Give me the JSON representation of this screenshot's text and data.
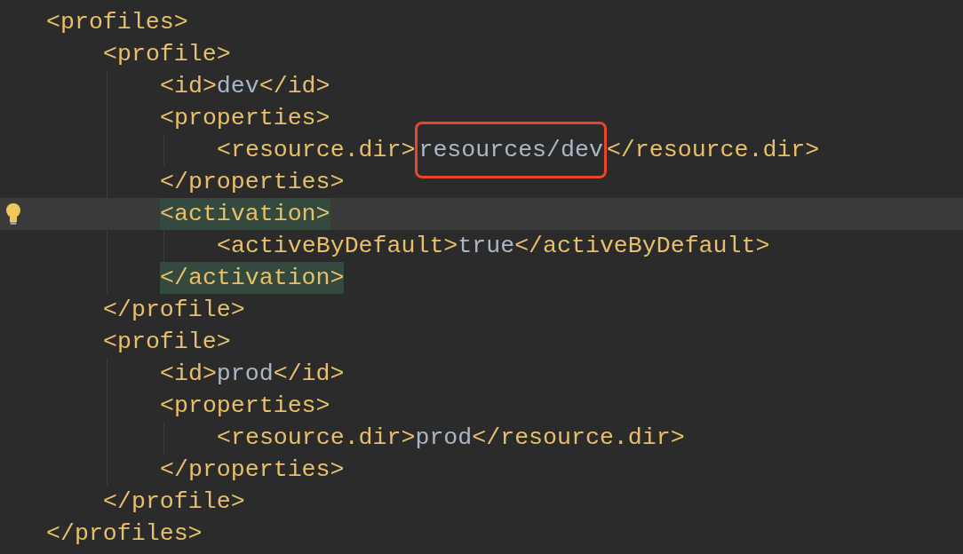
{
  "editor": {
    "lines": [
      {
        "parts": [
          {
            "kind": "tag",
            "text": "<profiles>"
          }
        ],
        "children": [
          {
            "parts": [
              {
                "kind": "tag",
                "text": "<profile>"
              }
            ],
            "children": [
              {
                "parts": [
                  {
                    "kind": "tag",
                    "text": "<id>"
                  },
                  {
                    "kind": "text",
                    "text": "dev"
                  },
                  {
                    "kind": "tag",
                    "text": "</id>"
                  }
                ]
              },
              {
                "parts": [
                  {
                    "kind": "tag",
                    "text": "<properties>"
                  }
                ],
                "children": [
                  {
                    "parts": [
                      {
                        "kind": "tag",
                        "text": "<resource.dir>"
                      },
                      {
                        "kind": "text",
                        "text": "resources/dev",
                        "boxed": true
                      },
                      {
                        "kind": "tag",
                        "text": "</resource.dir>"
                      }
                    ]
                  }
                ]
              },
              {
                "parts": [
                  {
                    "kind": "tag",
                    "text": "</properties>"
                  }
                ]
              },
              {
                "current": true,
                "bulb": true,
                "parts": [
                  {
                    "kind": "tag",
                    "text": "<activation>",
                    "matched": true
                  }
                ],
                "children": [
                  {
                    "parts": [
                      {
                        "kind": "tag",
                        "text": "<activeByDefault>"
                      },
                      {
                        "kind": "text",
                        "text": "true"
                      },
                      {
                        "kind": "tag",
                        "text": "</activeByDefault>"
                      }
                    ]
                  }
                ]
              },
              {
                "parts": [
                  {
                    "kind": "tag",
                    "text": "</activation>",
                    "matched": true
                  }
                ]
              }
            ]
          },
          {
            "parts": [
              {
                "kind": "tag",
                "text": "</profile>"
              }
            ]
          },
          {
            "parts": [
              {
                "kind": "tag",
                "text": "<profile>"
              }
            ],
            "children": [
              {
                "parts": [
                  {
                    "kind": "tag",
                    "text": "<id>"
                  },
                  {
                    "kind": "text",
                    "text": "prod"
                  },
                  {
                    "kind": "tag",
                    "text": "</id>"
                  }
                ]
              },
              {
                "parts": [
                  {
                    "kind": "tag",
                    "text": "<properties>"
                  }
                ],
                "children": [
                  {
                    "parts": [
                      {
                        "kind": "tag",
                        "text": "<resource.dir>"
                      },
                      {
                        "kind": "text",
                        "text": "prod"
                      },
                      {
                        "kind": "tag",
                        "text": "</resource.dir>"
                      }
                    ]
                  }
                ]
              },
              {
                "parts": [
                  {
                    "kind": "tag",
                    "text": "</properties>"
                  }
                ]
              }
            ]
          },
          {
            "parts": [
              {
                "kind": "tag",
                "text": "</profile>"
              }
            ]
          }
        ]
      },
      {
        "parts": [
          {
            "kind": "tag",
            "text": "</profiles>"
          }
        ]
      }
    ]
  }
}
